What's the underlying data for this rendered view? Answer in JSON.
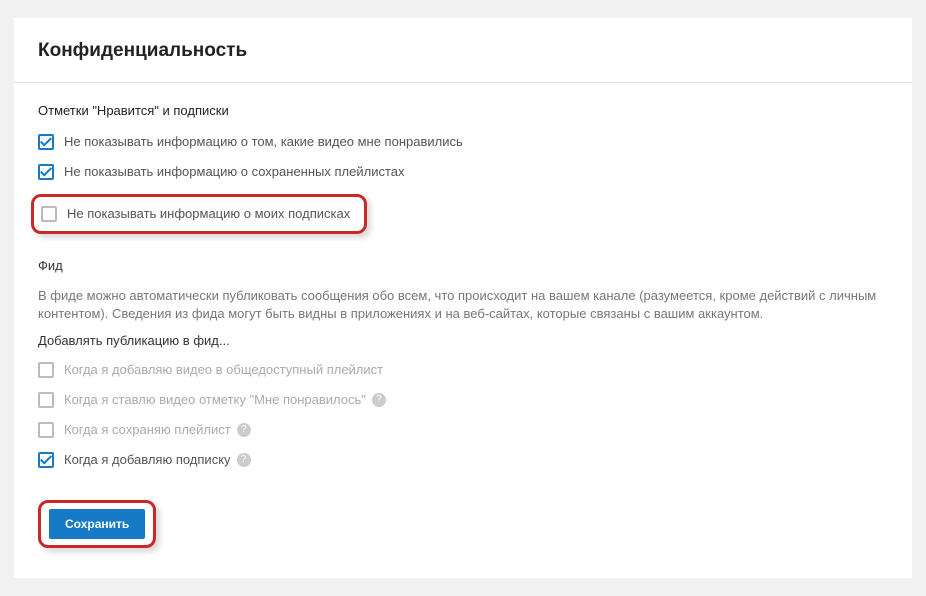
{
  "header": {
    "title": "Конфиденциальность"
  },
  "likes_section": {
    "title": "Отметки \"Нравится\" и подписки",
    "items": [
      {
        "label": "Не показывать информацию о том, какие видео мне понравились",
        "checked": true
      },
      {
        "label": "Не показывать информацию о сохраненных плейлистах",
        "checked": true
      },
      {
        "label": "Не показывать информацию о моих подписках",
        "checked": false
      }
    ]
  },
  "feed_section": {
    "title": "Фид",
    "description": "В фиде можно автоматически публиковать сообщения обо всем, что происходит на вашем канале (разумеется, кроме действий с личным контентом). Сведения из фида могут быть видны в приложениях и на веб-сайтах, которые связаны с вашим аккаунтом.",
    "subheader": "Добавлять публикацию в фид...",
    "items": [
      {
        "label": "Когда я добавляю видео в общедоступный плейлист",
        "checked": false,
        "disabled": true,
        "help": false
      },
      {
        "label": "Когда я ставлю видео отметку \"Мне понравилось\"",
        "checked": false,
        "disabled": true,
        "help": true
      },
      {
        "label": "Когда я сохраняю плейлист",
        "checked": false,
        "disabled": true,
        "help": true
      },
      {
        "label": "Когда я добавляю подписку",
        "checked": true,
        "disabled": false,
        "help": true
      }
    ]
  },
  "actions": {
    "save": "Сохранить"
  },
  "help_glyph": "?"
}
